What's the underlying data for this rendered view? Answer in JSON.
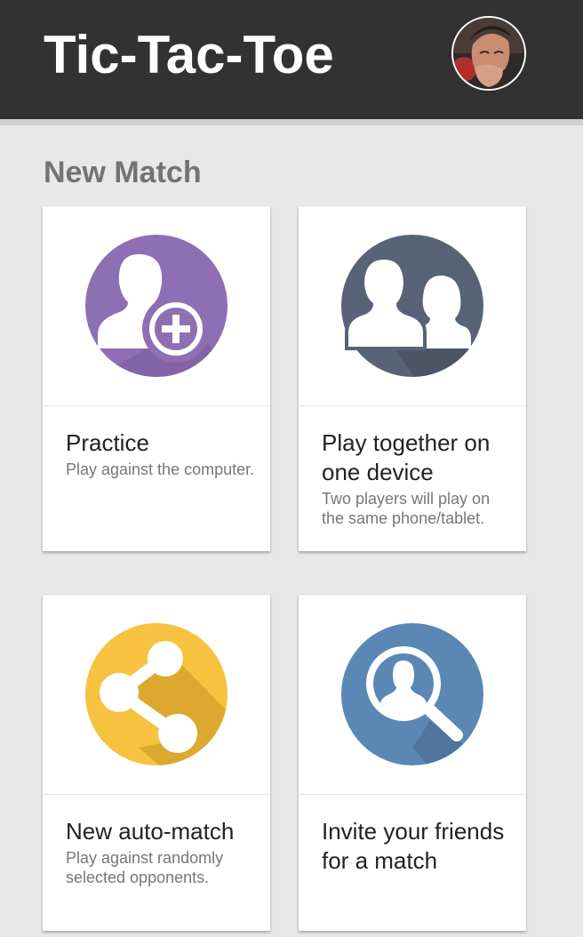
{
  "app_bar": {
    "title": "Tic-Tac-Toe",
    "avatar_icon": "user-avatar"
  },
  "section": {
    "title": "New Match"
  },
  "cards": [
    {
      "title": "Practice",
      "description": "Play against the computer.",
      "icon": "add-user-icon",
      "color": "#8e6fb3"
    },
    {
      "title": "Play together on one device",
      "description": "Two players will play on the same phone/tablet.",
      "icon": "two-users-icon",
      "color": "#586377"
    },
    {
      "title": "New auto-match",
      "description": "Play against randomly selected opponents.",
      "icon": "share-icon",
      "color": "#f6c23f"
    },
    {
      "title": "Invite your friends for a match",
      "description": "",
      "icon": "search-user-icon",
      "color": "#5b87b5"
    }
  ],
  "colors": {
    "app_bar": "#323232",
    "background": "#e8e8e8",
    "section_title": "#737373"
  }
}
